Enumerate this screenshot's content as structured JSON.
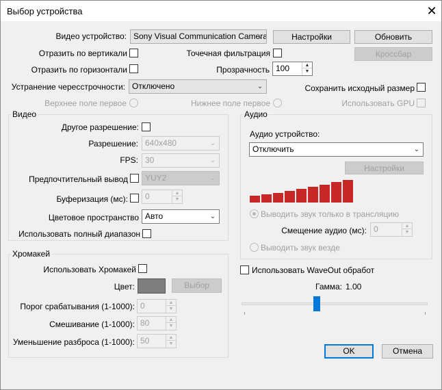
{
  "window": {
    "title": "Выбор устройства",
    "close_icon": "close-icon"
  },
  "top": {
    "video_device_label": "Видео устройство:",
    "video_device_value": "Sony Visual Communication Camera",
    "settings_button": "Настройки",
    "refresh_button": "Обновить",
    "flip_vertical_label": "Отразить по вертикали",
    "point_filter_label": "Точечная фильтрация",
    "crossbar_button": "Кроссбар",
    "flip_horizontal_label": "Отразить по горизонтали",
    "opacity_label": "Прозрачность",
    "opacity_value": "100",
    "deinterlace_label": "Устранение чересстрочности:",
    "deinterlace_value": "Отключено",
    "keep_size_label": "Сохранить исходный размер",
    "top_field_first_label": "Верхнее поле первое",
    "bottom_field_first_label": "Нижнее поле первое",
    "use_gpu_label": "Использовать GPU"
  },
  "video": {
    "group_title": "Видео",
    "custom_resolution_label": "Другое разрешение:",
    "resolution_label": "Разрешение:",
    "resolution_value": "640x480",
    "fps_label": "FPS:",
    "fps_value": "30",
    "preferred_output_label": "Предпочтительный вывод",
    "preferred_output_value": "YUY2",
    "buffering_label": "Буферизация (мс):",
    "buffering_value": "0",
    "color_space_label": "Цветовое пространство",
    "color_space_value": "Авто",
    "full_range_label": "Использовать полный диапазон"
  },
  "audio": {
    "group_title": "Аудио",
    "audio_device_label": "Аудио устройство:",
    "audio_device_value": "Отключить",
    "settings_button": "Настройки",
    "level_meter": {
      "segments": 9,
      "color": "#c62828"
    },
    "stream_only_label": "Выводить звук только в трансляцию",
    "audio_offset_label": "Смещение аудио (мс):",
    "audio_offset_value": "0",
    "everywhere_label": "Выводить звук везде",
    "waveout_label": "Использовать WaveOut обработ",
    "gamma_label": "Гамма:",
    "gamma_value": "1.00"
  },
  "chroma": {
    "group_title": "Хромакей",
    "use_chroma_label": "Использовать Хромакей",
    "color_label": "Цвет:",
    "color_swatch": "#7f7f7f",
    "select_button": "Выбор",
    "threshold_label": "Порог срабатывания (1-1000):",
    "threshold_value": "0",
    "blend_label": "Смешивание (1-1000):",
    "blend_value": "80",
    "spill_label": "Уменьшение разброса (1-1000):",
    "spill_value": "50"
  },
  "dialog": {
    "ok_button": "OK",
    "cancel_button": "Отмена"
  },
  "colors": {
    "accent": "#0078d7",
    "meter": "#c62828",
    "background": "#f0f0f0"
  }
}
